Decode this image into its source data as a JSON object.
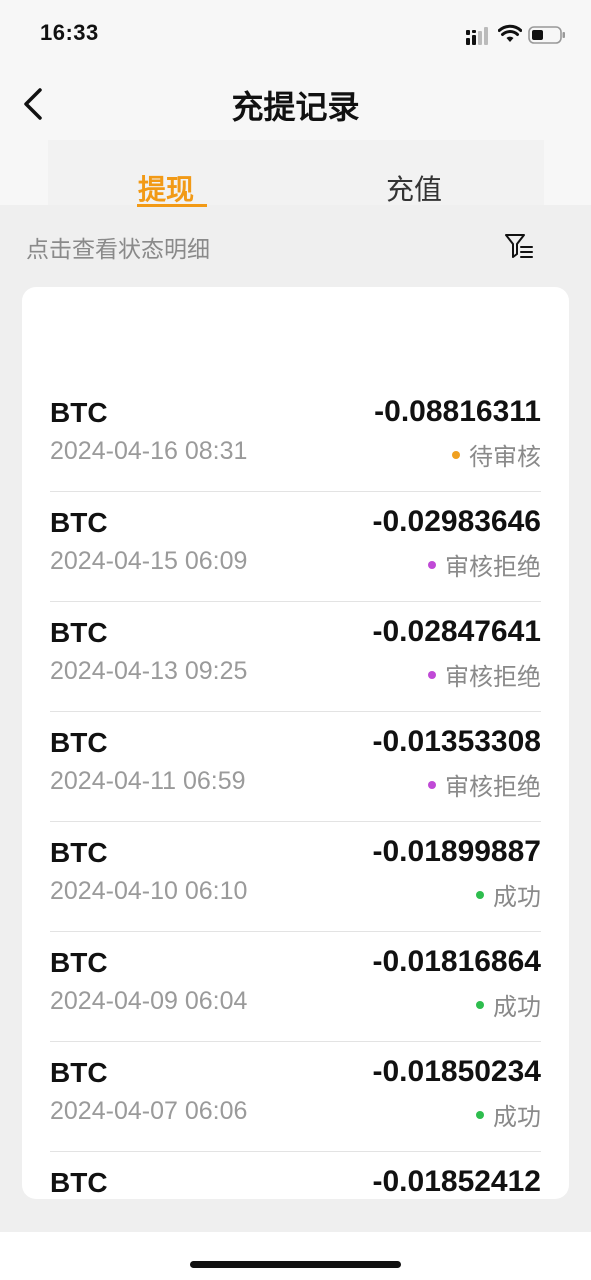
{
  "status_bar": {
    "time": "16:33"
  },
  "nav": {
    "title": "充提记录"
  },
  "tabs": [
    {
      "label": "提现"
    },
    {
      "label": "充值"
    }
  ],
  "hint": "点击查看状态明细",
  "records": [
    {
      "coin": "BTC",
      "date": "2024-04-16 08:31",
      "amount": "-0.08816311",
      "status": "待审核",
      "status_color": "#f0a020"
    },
    {
      "coin": "BTC",
      "date": "2024-04-15 06:09",
      "amount": "-0.02983646",
      "status": "审核拒绝",
      "status_color": "#c04ad6"
    },
    {
      "coin": "BTC",
      "date": "2024-04-13 09:25",
      "amount": "-0.02847641",
      "status": "审核拒绝",
      "status_color": "#c04ad6"
    },
    {
      "coin": "BTC",
      "date": "2024-04-11 06:59",
      "amount": "-0.01353308",
      "status": "审核拒绝",
      "status_color": "#c04ad6"
    },
    {
      "coin": "BTC",
      "date": "2024-04-10 06:10",
      "amount": "-0.01899887",
      "status": "成功",
      "status_color": "#2ebd4e"
    },
    {
      "coin": "BTC",
      "date": "2024-04-09 06:04",
      "amount": "-0.01816864",
      "status": "成功",
      "status_color": "#2ebd4e"
    },
    {
      "coin": "BTC",
      "date": "2024-04-07 06:06",
      "amount": "-0.01850234",
      "status": "成功",
      "status_color": "#2ebd4e"
    },
    {
      "coin": "BTC",
      "date": "",
      "amount": "-0.01852412",
      "status": "",
      "status_color": "#2ebd4e"
    }
  ],
  "colors": {
    "accent": "#f29a16"
  },
  "icons": [
    "signal-icon",
    "wifi-icon",
    "battery-icon",
    "back-arrow-icon",
    "filter-icon"
  ]
}
